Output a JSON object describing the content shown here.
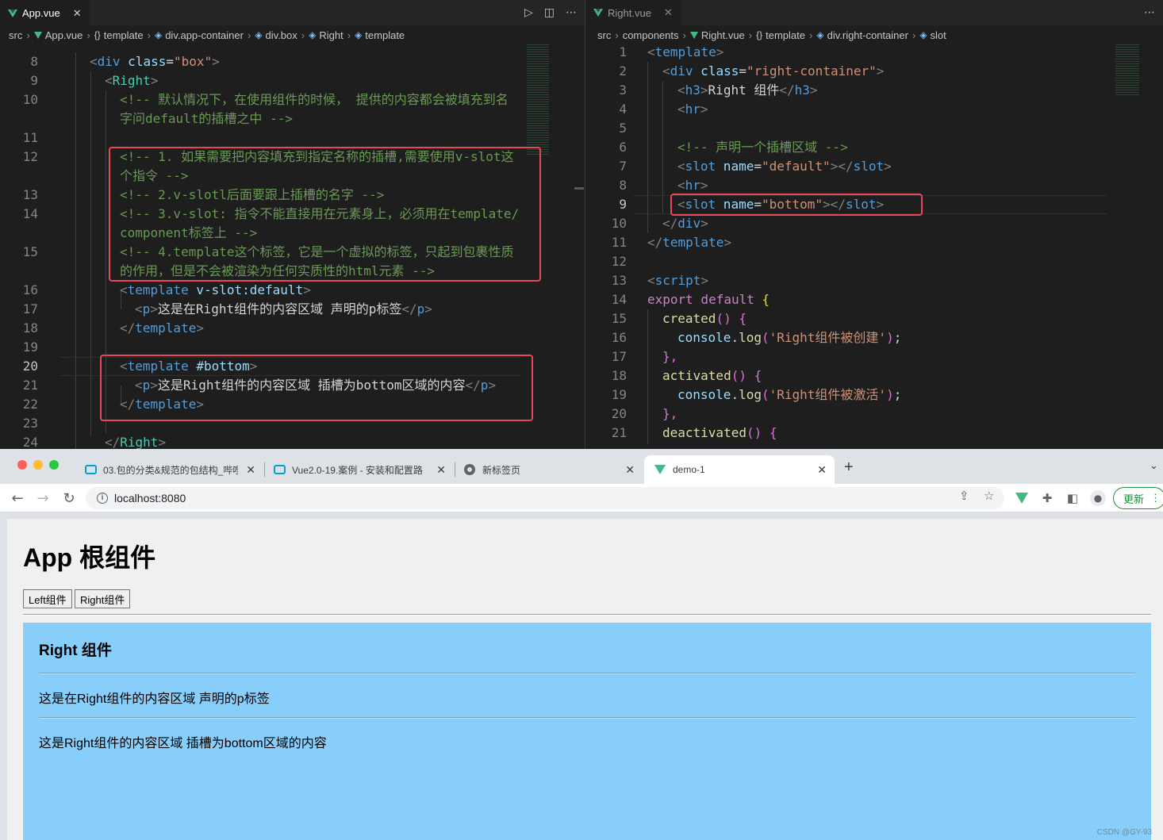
{
  "left_editor": {
    "tab_label": "App.vue",
    "breadcrumb": [
      "src",
      "App.vue",
      "template",
      "div.app-container",
      "div.box",
      "Right",
      "template"
    ],
    "line_numbers": [
      "8",
      "9",
      "10",
      "11",
      "12",
      "13",
      "14",
      "15",
      "16",
      "17",
      "18",
      "19",
      "20",
      "21",
      "22",
      "23",
      "24"
    ],
    "lines": {
      "l8_open": "<",
      "l8_tag": "div",
      "l8_attr": " class",
      "l8_eq": "=",
      "l8_val": "\"box\"",
      "l8_close": ">",
      "l9_open": "<",
      "l9_tag": "Right",
      "l9_close": ">",
      "l10a": "<!-- 默认情况下，在使用组件的时候， 提供的内容都会被填充到名",
      "l10b": "字问default的插槽之中 -->",
      "l12a": "<!-- 1. 如果需要把内容填充到指定名称的插槽,需要使用v-slot这",
      "l12b": "个指令 -->",
      "l13": "<!-- 2.v-slotl后面要跟上插槽的名字 -->",
      "l14a": "<!-- 3.v-slot: 指令不能直接用在元素身上，必须用在template/",
      "l14b": "component标签上 -->",
      "l15a": "<!-- 4.template这个标签，它是一个虚拟的标签，只起到包裹性质",
      "l15b": "的作用，但是不会被渲染为任何实质性的html元素 -->",
      "l16_open": "<",
      "l16_tag": "template",
      "l16_attr": " v-slot:default",
      "l16_close": ">",
      "l17_open": "<",
      "l17_tag": "p",
      "l17_close1": ">",
      "l17_text": "这是在Right组件的内容区域 声明的p标签",
      "l17_open2": "</",
      "l17_tag2": "p",
      "l17_close2": ">",
      "l18_open": "</",
      "l18_tag": "template",
      "l18_close": ">",
      "l20_open": "<",
      "l20_tag": "template",
      "l20_attr": " #bottom",
      "l20_close": ">",
      "l21_open": "<",
      "l21_tag": "p",
      "l21_close1": ">",
      "l21_text": "这是Right组件的内容区域 插槽为bottom区域的内容",
      "l21_open2": "</",
      "l21_tag2": "p",
      "l21_close2": ">",
      "l22_open": "</",
      "l22_tag": "template",
      "l22_close": ">",
      "l24_open": "</",
      "l24_tag": "Right",
      "l24_close": ">"
    }
  },
  "right_editor": {
    "tab_label": "Right.vue",
    "breadcrumb": [
      "src",
      "components",
      "Right.vue",
      "template",
      "div.right-container",
      "slot"
    ],
    "line_numbers": [
      "1",
      "2",
      "3",
      "4",
      "5",
      "6",
      "7",
      "8",
      "9",
      "10",
      "11",
      "12",
      "13",
      "14",
      "15",
      "16",
      "17",
      "18",
      "19",
      "20",
      "21"
    ],
    "lines": {
      "r1_open": "<",
      "r1_tag": "template",
      "r1_close": ">",
      "r2_open": "<",
      "r2_tag": "div",
      "r2_attr": " class",
      "r2_eq": "=",
      "r2_val": "\"right-container\"",
      "r2_close": ">",
      "r3_open": "<",
      "r3_tag": "h3",
      "r3_close1": ">",
      "r3_text": "Right 组件",
      "r3_open2": "</",
      "r3_tag2": "h3",
      "r3_close2": ">",
      "r4_open": "<",
      "r4_tag": "hr",
      "r4_close": ">",
      "r6": "<!-- 声明一个插槽区域 -->",
      "r7_open": "<",
      "r7_tag": "slot",
      "r7_attr": " name",
      "r7_eq": "=",
      "r7_val": "\"default\"",
      "r7_mid": "></",
      "r7_tag2": "slot",
      "r7_close": ">",
      "r8_open": "<",
      "r8_tag": "hr",
      "r8_close": ">",
      "r9_open": "<",
      "r9_tag": "slot",
      "r9_attr": " name",
      "r9_eq": "=",
      "r9_val": "\"bottom\"",
      "r9_mid": "></",
      "r9_tag2": "slot",
      "r9_close": ">",
      "r10_open": "</",
      "r10_tag": "div",
      "r10_close": ">",
      "r11_open": "</",
      "r11_tag": "template",
      "r11_close": ">",
      "r13_open": "<",
      "r13_tag": "script",
      "r13_close": ">",
      "r14_kw": "export default",
      "r14_brace": " {",
      "r15_fn": "created",
      "r15_paren": "()",
      "r15_brace": " {",
      "r16_var": "console",
      "r16_dot": ".",
      "r16_fn": "log",
      "r16_p1": "(",
      "r16_str": "'Right组件被创建'",
      "r16_p2": ")",
      "r16_semi": ";",
      "r17": "},",
      "r18_fn": "activated",
      "r18_paren": "()",
      "r18_brace": " {",
      "r19_var": "console",
      "r19_dot": ".",
      "r19_fn": "log",
      "r19_p1": "(",
      "r19_str": "'Right组件被激活'",
      "r19_p2": ")",
      "r19_semi": ";",
      "r20": "},",
      "r21_fn": "deactivated",
      "r21_paren": "()",
      "r21_brace": " {"
    }
  },
  "browser": {
    "tabs": [
      {
        "label": "03.包的分类&规范的包结构_哔哩"
      },
      {
        "label": "Vue2.0-19.案例 - 安装和配置路"
      },
      {
        "label": "新标签页"
      },
      {
        "label": "demo-1"
      }
    ],
    "new_tab": "+",
    "url": "localhost:8080",
    "update_button": "更新",
    "page": {
      "title": "App 根组件",
      "buttons": [
        "Left组件",
        "Right组件"
      ],
      "right_heading": "Right 组件",
      "slot_default_text": "这是在Right组件的内容区域 声明的p标签",
      "slot_bottom_text": "这是Right组件的内容区域 插槽为bottom区域的内容"
    },
    "watermark": "CSDN @GY-93"
  }
}
